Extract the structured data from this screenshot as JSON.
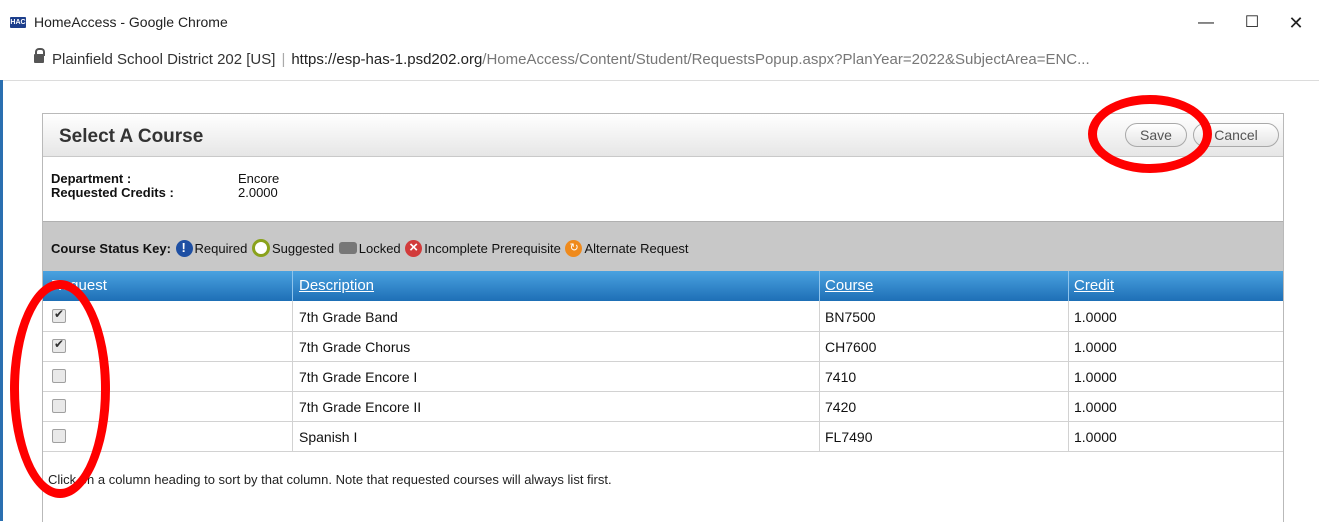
{
  "window": {
    "badge": "HAC",
    "title": "HomeAccess - Google Chrome",
    "min": "—",
    "max": "☐",
    "close": "✕"
  },
  "address": {
    "site_name": "Plainfield School District 202 [US]",
    "separator": "|",
    "url_host": "https://esp-has-1.psd202.org",
    "url_path": "/HomeAccess/Content/Student/RequestsPopup.aspx?PlanYear=2022&SubjectArea=ENC..."
  },
  "dialog": {
    "title": "Select A Course",
    "save_label": "Save",
    "cancel_label": "Cancel",
    "department_label": "Department :",
    "department_value": "Encore",
    "credits_label": "Requested Credits :",
    "credits_value": "2.0000"
  },
  "status_key": {
    "label": "Course Status Key:",
    "items": [
      {
        "icon": "required-icon",
        "text": "Required"
      },
      {
        "icon": "suggested-icon",
        "text": "Suggested"
      },
      {
        "icon": "locked-icon",
        "text": "Locked"
      },
      {
        "icon": "incomplete-prerequisite-icon",
        "text": "Incomplete Prerequisite"
      },
      {
        "icon": "alternate-request-icon",
        "text": "Alternate Request"
      }
    ]
  },
  "table": {
    "headers": [
      "Request",
      "Description",
      "Course",
      "Credit"
    ],
    "rows": [
      {
        "checked": true,
        "description": "7th Grade Band",
        "course": "BN7500",
        "credit": "1.0000"
      },
      {
        "checked": true,
        "description": "7th Grade Chorus",
        "course": "CH7600",
        "credit": "1.0000"
      },
      {
        "checked": false,
        "description": "7th Grade Encore I",
        "course": "7410",
        "credit": "1.0000"
      },
      {
        "checked": false,
        "description": "7th Grade Encore II",
        "course": "7420",
        "credit": "1.0000"
      },
      {
        "checked": false,
        "description": "Spanish I",
        "course": "FL7490",
        "credit": "1.0000"
      }
    ]
  },
  "footnote": "Click on a column heading to sort by that column. Note that requested courses will always list first.",
  "colors": {
    "header_blue": "#1e6fb6",
    "annotation_red": "#ff0000"
  }
}
